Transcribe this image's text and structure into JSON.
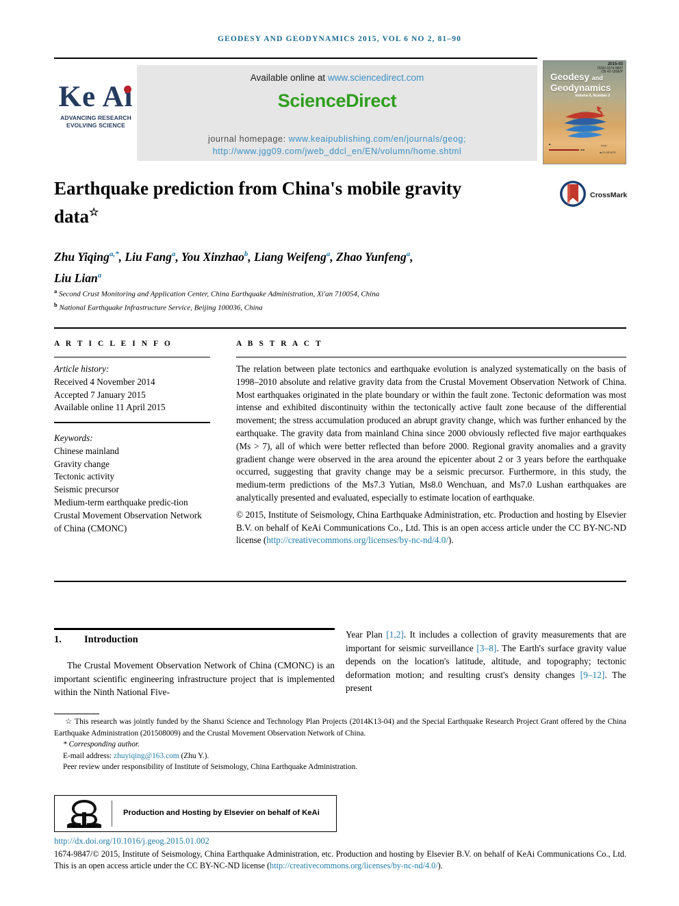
{
  "running_head": "Geodesy and Geodynamics 2015, Vol 6 No 2, 81–90",
  "masthead": {
    "available_prefix": "Available online at ",
    "sciencedirect_url": "www.sciencedirect.com",
    "sciencedirect_wordmark": "ScienceDirect",
    "homepage_label": "journal homepage: ",
    "homepage_url_1": "www.keaipublishing.com/en/journals/geog;",
    "homepage_url_2": "http://www.jgg09.com/jweb_ddcl_en/EN/volumn/home.shtml",
    "keai_wordmark": "Ke Ai",
    "keai_tagline_1": "ADVANCING RESEARCH",
    "keai_tagline_2": "EVOLVING SCIENCE",
    "cover": {
      "issue_code": "2015-03",
      "issue_sub_1": "ISSN 1674-9847",
      "issue_sub_2": "CN 42-1806/P",
      "title_line_1": "Geodesy",
      "title_and": "and",
      "title_line_2": "Geodynamics",
      "volume_line": "Volume 6, Number 2"
    }
  },
  "article": {
    "title": "Earthquake prediction from China's mobile gravity data",
    "title_footnote_marker": "☆",
    "crossmark_label": "CrossMark",
    "authors": [
      {
        "name": "Zhu Yiqing",
        "sup": "a,*"
      },
      {
        "name": "Liu Fang",
        "sup": "a"
      },
      {
        "name": "You Xinzhao",
        "sup": "b"
      },
      {
        "name": "Liang Weifeng",
        "sup": "a"
      },
      {
        "name": "Zhao Yunfeng",
        "sup": "a"
      },
      {
        "name": "Liu Lian",
        "sup": "a"
      }
    ],
    "affiliations": [
      {
        "marker": "a",
        "text": "Second Crust Monitoring and Application Center, China Earthquake Administration, Xi'an 710054, China"
      },
      {
        "marker": "b",
        "text": "National Earthquake Infrastructure Service, Beijing 100036, China"
      }
    ]
  },
  "article_info": {
    "heading": "A R T I C L E   I N F O",
    "history_label": "Article history:",
    "received": "Received 4 November 2014",
    "accepted": "Accepted 7 January 2015",
    "available_online": "Available online 11 April 2015",
    "keywords_label": "Keywords:",
    "keywords": [
      "Chinese mainland",
      "Gravity change",
      "Tectonic activity",
      "Seismic precursor",
      "Medium-term earthquake predic-tion",
      "Crustal Movement Observation Network of China (CMONC)"
    ]
  },
  "abstract": {
    "heading": "A B S T R A C T",
    "body": "The relation between plate tectonics and earthquake evolution is analyzed systematically on the basis of 1998–2010 absolute and relative gravity data from the Crustal Movement Observation Network of China. Most earthquakes originated in the plate boundary or within the fault zone. Tectonic deformation was most intense and exhibited discontinuity within the tectonically active fault zone because of the differential movement; the stress accumulation produced an abrupt gravity change, which was further enhanced by the earthquake. The gravity data from mainland China since 2000 obviously reflected five major earthquakes (Ms > 7), all of which were better reflected than before 2000. Regional gravity anomalies and a gravity gradient change were observed in the area around the epicenter about 2 or 3 years before the earthquake occurred, suggesting that gravity change may be a seismic precursor. Furthermore, in this study, the medium-term predictions of the Ms7.3 Yutian, Ms8.0 Wenchuan, and Ms7.0 Lushan earthquakes are analytically presented and evaluated, especially to estimate location of earthquake.",
    "copyright_pre": "© 2015, Institute of Seismology, China Earthquake Administration, etc. Production and hosting by Elsevier B.V. on behalf of KeAi Communications Co., Ltd. This is an open access article under the CC BY-NC-ND license (",
    "copyright_link": "http://creativecommons.org/licenses/by-nc-nd/4.0/",
    "copyright_post": ")."
  },
  "introduction": {
    "number": "1.",
    "heading": "Introduction",
    "left_pre": "The Crustal Movement Observation Network of China (CMONC) is an important scientific engineering infrastructure project that is implemented within the Ninth National Five-",
    "right_1": "Year Plan ",
    "right_ref_1": "[1,2]",
    "right_2": ". It includes a collection of gravity measurements that are important for seismic surveillance ",
    "right_ref_2": "[3–8]",
    "right_3": ". The Earth's surface gravity value depends on the location's latitude, altitude, and topography; tectonic deformation motion; and resulting crust's density changes ",
    "right_ref_3": "[9–12]",
    "right_4": ". The present"
  },
  "footnotes": {
    "funding": "☆ This research was jointly funded by the Shanxi Science and Technology Plan Projects (2014K13-04) and the Special Earthquake Research Project Grant offered by the China Earthquake Administration (201508009) and the Crustal Movement Observation Network of China.",
    "corresponding": "* Corresponding author.",
    "email_label": "E-mail address: ",
    "email": "zhuyiqing@163.com",
    "email_suffix": " (Zhu Y.).",
    "peer_review": "Peer review under responsibility of Institute of Seismology, China Earthquake Administration."
  },
  "publisher_box": {
    "elsevier_wordmark": "ELSEVIER",
    "text": "Production and Hosting by Elsevier on behalf of KeAi"
  },
  "footer": {
    "doi": "http://dx.doi.org/10.1016/j.geog.2015.01.002",
    "legal_pre": "1674-9847/© 2015, Institute of Seismology, China Earthquake Administration, etc. Production and hosting by Elsevier B.V. on behalf of KeAi Communications Co., Ltd. This is an open access article under the CC BY-NC-ND license (",
    "legal_link": "http://creativecommons.org/licenses/by-nc-nd/4.0/",
    "legal_post": ")."
  },
  "colors": {
    "link": "#1f7ba8",
    "sciencedirect_green": "#2f9e1f",
    "running_head": "#1b6b8f",
    "keai_navy": "#243a5e",
    "keai_red": "#b8202a"
  }
}
